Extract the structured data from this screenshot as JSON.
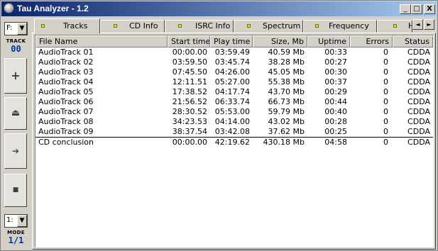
{
  "window": {
    "title": "Tau Analyzer - 1.2",
    "controls": {
      "minimize": "_",
      "maximize": "□",
      "close": "X"
    }
  },
  "left_panel": {
    "drive_select": "F:",
    "track_label": "TRACK",
    "track_value": "00",
    "buttons": [
      {
        "icon": "add-icon",
        "glyph": "+"
      },
      {
        "icon": "eject-icon",
        "glyph": "⏏"
      },
      {
        "icon": "next-icon",
        "glyph": "➔"
      },
      {
        "icon": "stop-icon",
        "glyph": "■"
      }
    ],
    "mode_select": "1:",
    "mode_label": "MODE",
    "mode_value": "1/1"
  },
  "tabs": [
    {
      "label": "Tracks",
      "active": true
    },
    {
      "label": "CD Info",
      "active": false
    },
    {
      "label": "ISRC Info",
      "active": false
    },
    {
      "label": "Spectrum",
      "active": false
    },
    {
      "label": "Frequency",
      "active": false
    },
    {
      "label": "H",
      "active": false
    }
  ],
  "tab_scroll": {
    "left": "◄",
    "right": "►"
  },
  "table": {
    "columns": [
      "File Name",
      "Start time",
      "Play time",
      "Size, Mb",
      "Uptime",
      "Errors",
      "Status"
    ],
    "rows": [
      [
        "AudioTrack 01",
        "00:00.00",
        "03:59.49",
        "40.59 Mb",
        "00:33",
        "0",
        "CDDA"
      ],
      [
        "AudioTrack 02",
        "03:59.50",
        "03:45.74",
        "38.28 Mb",
        "00:27",
        "0",
        "CDDA"
      ],
      [
        "AudioTrack 03",
        "07:45.50",
        "04:26.00",
        "45.05 Mb",
        "00:30",
        "0",
        "CDDA"
      ],
      [
        "AudioTrack 04",
        "12:11.51",
        "05:27.00",
        "55.38 Mb",
        "00:37",
        "0",
        "CDDA"
      ],
      [
        "AudioTrack 05",
        "17:38.52",
        "04:17.74",
        "43.70 Mb",
        "00:29",
        "0",
        "CDDA"
      ],
      [
        "AudioTrack 06",
        "21:56.52",
        "06:33.74",
        "66.73 Mb",
        "00:44",
        "0",
        "CDDA"
      ],
      [
        "AudioTrack 07",
        "28:30.52",
        "05:53.00",
        "59.79 Mb",
        "00:40",
        "0",
        "CDDA"
      ],
      [
        "AudioTrack 08",
        "34:23.53",
        "04:14.00",
        "43.02 Mb",
        "00:28",
        "0",
        "CDDA"
      ],
      [
        "AudioTrack 09",
        "38:37.54",
        "03:42.08",
        "37.62 Mb",
        "00:25",
        "0",
        "CDDA"
      ]
    ],
    "summary": [
      "CD conclusion",
      "00:00.00",
      "42:19.62",
      "430.18 Mb",
      "04:58",
      "0",
      "CDDA"
    ]
  }
}
